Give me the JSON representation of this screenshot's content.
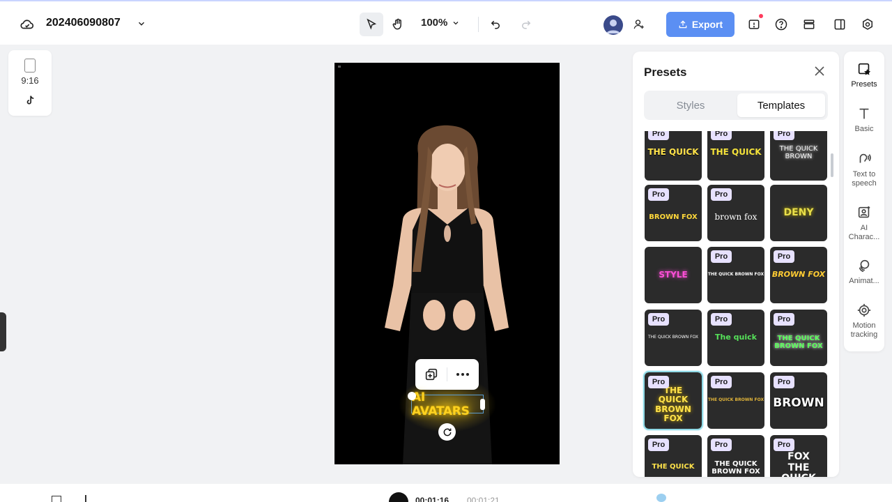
{
  "header": {
    "project_title": "202406090807",
    "zoom": "100%",
    "export_label": "Export"
  },
  "ratio_panel": {
    "ratio": "9:16"
  },
  "canvas": {
    "caption_text": "AI AVATARS"
  },
  "presets": {
    "title": "Presets",
    "tabs": [
      {
        "label": "Styles",
        "active": false
      },
      {
        "label": "Templates",
        "active": true
      }
    ],
    "pro_label": "Pro",
    "templates": [
      {
        "text": "THE QUICK",
        "pro": true,
        "color": "#ffe24a"
      },
      {
        "text": "THE QUICK",
        "pro": true,
        "color": "#f4e23a"
      },
      {
        "text": "THE QUICK BROWN",
        "pro": true,
        "color": "#f2f2f2"
      },
      {
        "text": "BROWN FOX",
        "pro": true,
        "color": "#ffd83a"
      },
      {
        "text": "brown fox",
        "pro": true,
        "color": "#ffffff"
      },
      {
        "text": "DENY",
        "pro": false,
        "color": "#e9df4a"
      },
      {
        "text": "STYLE",
        "pro": false,
        "color": "#ff4fd8"
      },
      {
        "text": "THE QUICK BROWN FOX",
        "pro": true,
        "color": "#ffffff"
      },
      {
        "text": "BROWN FOX",
        "pro": true,
        "color": "#ffcc33"
      },
      {
        "text": "THE QUICK BROWN FOX",
        "pro": true,
        "color": "#ffffff"
      },
      {
        "text": "The quick",
        "pro": true,
        "color": "#56e35a"
      },
      {
        "text": "THE QUICK BROWN FOX",
        "pro": true,
        "color": "#5aff5a"
      },
      {
        "text": "THE QUICK BROWN FOX",
        "pro": true,
        "color": "#ffe24a"
      },
      {
        "text": "THE QUICK BROWN FOX",
        "pro": true,
        "color": "#e0b43a"
      },
      {
        "text": "BROWN",
        "pro": true,
        "color": "#ffffff"
      },
      {
        "text": "THE QUICK",
        "pro": true,
        "color": "#ffe24a"
      },
      {
        "text": "THE QUICK BROWN FOX",
        "pro": true,
        "color": "#ffffff"
      },
      {
        "text": "FOX THE QUICK",
        "pro": true,
        "color": "#ffffff"
      }
    ]
  },
  "right_sidebar": {
    "items": [
      {
        "label": "Presets",
        "icon": "presets-icon",
        "active": true
      },
      {
        "label": "Basic",
        "icon": "text-icon",
        "active": false
      },
      {
        "label": "Text to speech",
        "icon": "speech-icon",
        "active": false
      },
      {
        "label": "AI Charac...",
        "icon": "ai-character-icon",
        "active": false
      },
      {
        "label": "Animat...",
        "icon": "animation-icon",
        "active": false
      },
      {
        "label": "Motion tracking",
        "icon": "motion-tracking-icon",
        "active": false
      }
    ]
  },
  "playback": {
    "current_time": "00:01:16",
    "total_time": "00:01:21"
  },
  "colors": {
    "accent": "#5b8ff3",
    "caption_yellow": "#ffd21f",
    "selection": "#8fd9e6"
  }
}
